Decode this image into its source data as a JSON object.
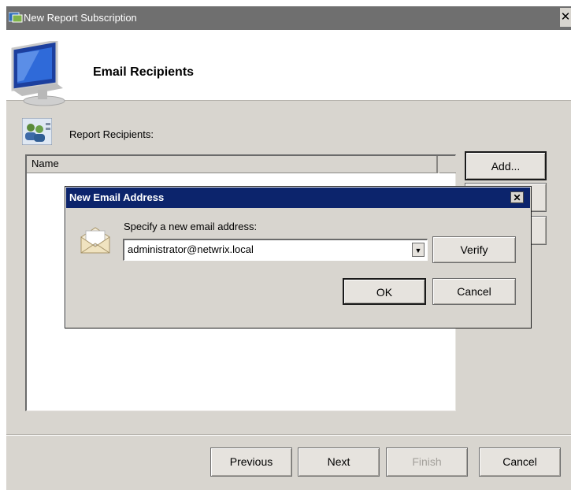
{
  "window": {
    "title": "New Report Subscription",
    "close_glyph": "✕"
  },
  "header": {
    "title": "Email Recipients",
    "icon": "monitor-icon"
  },
  "recipients": {
    "label": "Report Recipients:",
    "icon": "users-icon",
    "columns": [
      "Name"
    ],
    "add_label": "Add...",
    "items": []
  },
  "footer": {
    "previous": "Previous",
    "next": "Next",
    "finish": "Finish",
    "cancel": "Cancel"
  },
  "dialog": {
    "title": "New Email Address",
    "close_glyph": "✕",
    "prompt": "Specify a new email address:",
    "email_value": "administrator@netwrix.local",
    "combo_arrow": "▼",
    "verify": "Verify",
    "ok": "OK",
    "cancel": "Cancel",
    "icon": "envelope-icon"
  },
  "colors": {
    "dialog_title": "#0c246c",
    "window_title": "#6f6f6f",
    "chrome": "#d8d5cf"
  }
}
